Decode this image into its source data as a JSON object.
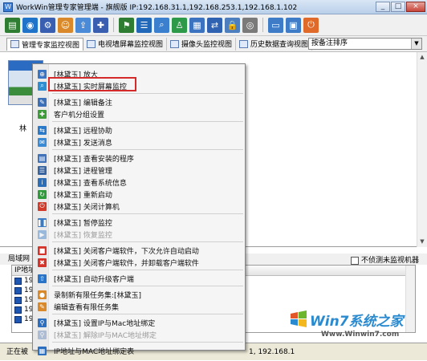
{
  "window": {
    "title": "WorkWin管理专家管理端 - 旗舰版 IP:192.168.31.1,192.168.253.1,192.168.1.102",
    "minimize": "_",
    "restore": "□",
    "close": "×"
  },
  "toolbar": {
    "icons": [
      "folder-icon",
      "globe-icon",
      "gear-icon",
      "group-icon",
      "export-icon",
      "tools-icon",
      "flag-icon",
      "rules-icon",
      "search-icon",
      "user-icon",
      "screens-icon",
      "network-icon",
      "lock-icon",
      "disc-icon",
      "document-icon",
      "monitor-icon",
      "exit-icon"
    ],
    "colors": [
      "#2f7d32",
      "#1f74c9",
      "#3a5fb0",
      "#d9892a",
      "#4a8ad6",
      "#3a5fb0",
      "#2f7d32",
      "#2168b9",
      "#3a80cf",
      "#2d9a4a",
      "#3b73c1",
      "#2f62b0",
      "#4d7fbf",
      "#7a7a7a",
      "#3e7cc8",
      "#3e7cc8",
      "#e06a2a"
    ]
  },
  "tabs": [
    {
      "label": "管理专家监控视图"
    },
    {
      "label": "电视墙屏幕监控视图"
    },
    {
      "label": "摄像头监控视图"
    },
    {
      "label": "历史数据查询视图"
    }
  ],
  "sort": {
    "value": "按备注排序",
    "arrow": "▼"
  },
  "monitor": {
    "thumb_label": "林"
  },
  "bottom_panel": {
    "title": "局域网",
    "checkbox_label": "不侦测未监视机器",
    "column_header": "IP地址",
    "rows": [
      "19",
      "19",
      "19",
      "19",
      "19"
    ]
  },
  "status": {
    "left": "正在被",
    "right": "1, 192.168.1"
  },
  "watermark": {
    "brand": "Win7系统之家",
    "url": "Www.Winwin7.com"
  },
  "context_menu": {
    "items": [
      {
        "label": "[林黛玉] 放大",
        "icon": "zoom-icon",
        "color": "#3a74c5",
        "disabled": false
      },
      {
        "label": "[林黛玉] 实时屏幕监控",
        "icon": "magnifier-icon",
        "color": "#2f8dd0",
        "disabled": false
      },
      {
        "label": "[林黛玉] 编辑备注",
        "icon": "pencil-icon",
        "color": "#3b6fb8",
        "disabled": false
      },
      {
        "label": "客户机分组设置",
        "icon": "group-icon",
        "color": "#3e9b3a",
        "disabled": false
      },
      {
        "label": "[林黛玉] 远程协助",
        "icon": "remote-icon",
        "color": "#2b7ac9",
        "disabled": false
      },
      {
        "label": "[林黛玉] 发送消息",
        "icon": "message-icon",
        "color": "#3a8bd4",
        "disabled": false
      },
      {
        "label": "[林黛玉] 查看安装的程序",
        "icon": "programs-icon",
        "color": "#4272b7",
        "disabled": false
      },
      {
        "label": "[林黛玉] 进程管理",
        "icon": "process-icon",
        "color": "#37639f",
        "disabled": false
      },
      {
        "label": "[林黛玉] 查看系统信息",
        "icon": "sysinfo-icon",
        "color": "#2d6fb6",
        "disabled": false
      },
      {
        "label": "[林黛玉] 重新启动",
        "icon": "restart-icon",
        "color": "#2e9a3a",
        "disabled": false
      },
      {
        "label": "[林黛玉] 关闭计算机",
        "icon": "power-icon",
        "color": "#d23a2a",
        "disabled": false
      },
      {
        "label": "[林黛玉] 暂停监控",
        "icon": "pause-icon",
        "color": "#3a7bc4",
        "disabled": false
      },
      {
        "label": "[林黛玉] 恢复监控",
        "icon": "play-icon",
        "color": "#4a8ad0",
        "disabled": true
      },
      {
        "label": "[林黛玉] 关闭客户端软件，下次允许自动启动",
        "icon": "stop-icon",
        "color": "#d5342a",
        "disabled": false
      },
      {
        "label": "[林黛玉] 关闭客户端软件，并卸载客户端软件",
        "icon": "uninstall-icon",
        "color": "#d5342a",
        "disabled": false
      },
      {
        "label": "[林黛玉] 自动升级客户端",
        "icon": "upgrade-icon",
        "color": "#2a74c8",
        "disabled": false
      },
      {
        "label": "录制新有限任务集:[林黛玉]",
        "icon": "record-icon",
        "color": "#d9892a",
        "disabled": false
      },
      {
        "label": "编辑查看有限任务集",
        "icon": "edit-tasks-icon",
        "color": "#d9892a",
        "disabled": false
      },
      {
        "label": "[林黛玉] 设置IP与Mac地址绑定",
        "icon": "bind-icon",
        "color": "#2c6fc0",
        "disabled": false
      },
      {
        "label": "[林黛玉] 解除IP与MAC地址绑定",
        "icon": "unbind-icon",
        "color": "#7090c0",
        "disabled": true
      },
      {
        "label": "IP地址与MAC地址绑定表",
        "icon": "table-icon",
        "color": "#2c6fc0",
        "disabled": false
      }
    ]
  }
}
